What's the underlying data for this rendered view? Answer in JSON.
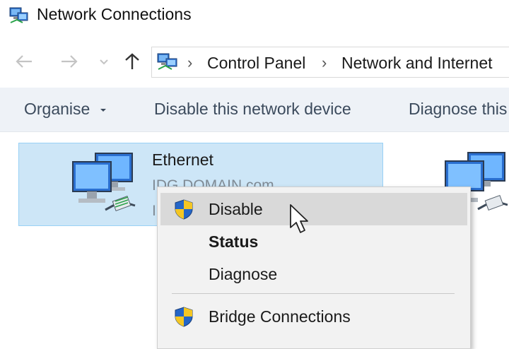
{
  "window": {
    "title": "Network Connections"
  },
  "nav": {
    "back_icon": "arrow-left-icon",
    "forward_icon": "arrow-right-icon",
    "recent_icon": "chevron-down-icon",
    "up_icon": "arrow-up-icon"
  },
  "breadcrumb": {
    "items": [
      "Control Panel",
      "Network and Internet"
    ]
  },
  "commands": {
    "organise": "Organise",
    "disable_device": "Disable this network device",
    "diagnose": "Diagnose this"
  },
  "connection": {
    "name": "Ethernet",
    "network": "IDG.DOMAIN.com",
    "adapter_partial": "In"
  },
  "context_menu": {
    "disable": "Disable",
    "status": "Status",
    "diagnose": "Diagnose",
    "bridge": "Bridge Connections"
  },
  "colors": {
    "selection_bg": "#cde6f7",
    "selection_border": "#99d1f5",
    "command_bar_bg": "#eef2f7",
    "menu_bg": "#f2f2f2",
    "menu_hover": "#d9d9d9"
  }
}
